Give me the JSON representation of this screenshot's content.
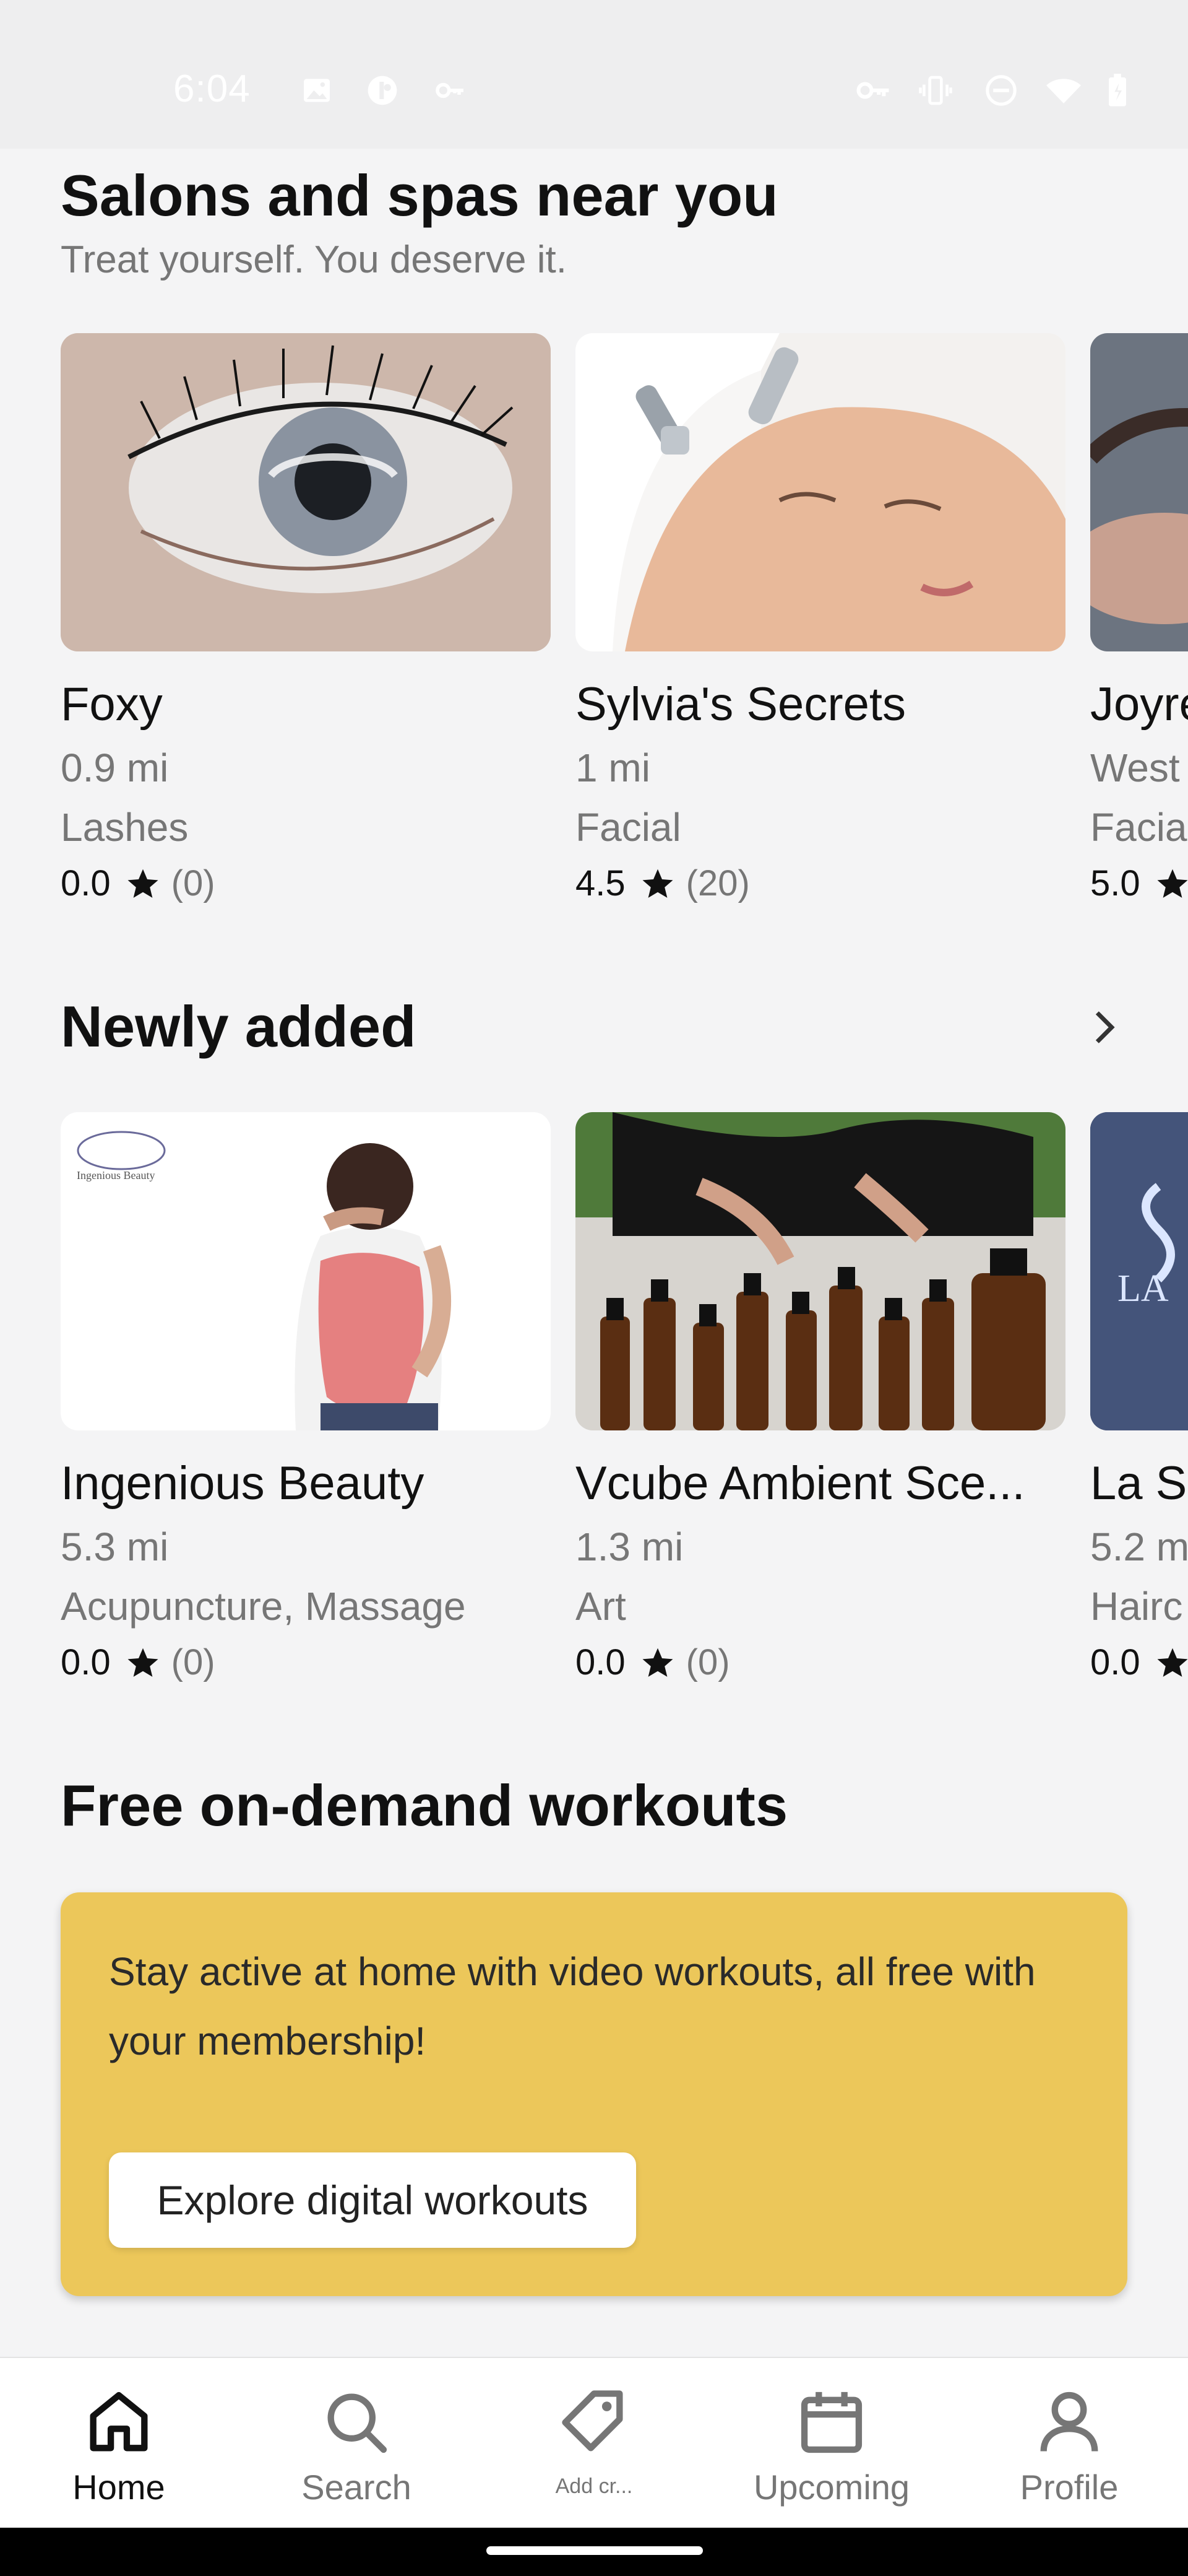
{
  "status_bar": {
    "time": "6:04",
    "left_icons": [
      "image-icon",
      "privacy-icon",
      "key-icon"
    ],
    "right_icons": [
      "vpn-key-icon",
      "vibrate-icon",
      "dnd-icon",
      "wifi-icon",
      "battery-icon"
    ]
  },
  "salons": {
    "title": "Salons and spas near you",
    "subtitle": "Treat yourself. You deserve it.",
    "cards": [
      {
        "name": "Foxy",
        "distance": "0.9 mi",
        "category": "Lashes",
        "rating": "0.0",
        "count": "(0)"
      },
      {
        "name": "Sylvia's Secrets",
        "distance": "1 mi",
        "category": "Facial",
        "rating": "4.5",
        "count": "(20)"
      },
      {
        "name": "Joyre",
        "distance": "West",
        "category": "Facia",
        "rating": "5.0",
        "count": ""
      }
    ]
  },
  "newly_added": {
    "title": "Newly added",
    "cards": [
      {
        "name": "Ingenious Beauty",
        "distance": "5.3 mi",
        "category": "Acupuncture, Massage",
        "rating": "0.0",
        "count": "(0)",
        "logo_text": "Ingenious Beauty"
      },
      {
        "name": "Vcube Ambient Sce...",
        "distance": "1.3 mi",
        "category": "Art",
        "rating": "0.0",
        "count": "(0)"
      },
      {
        "name": "La Sc",
        "distance": "5.2 m",
        "category": "Hairc",
        "rating": "0.0",
        "count": "",
        "sign_text": "LA"
      }
    ]
  },
  "workouts": {
    "title": "Free on-demand workouts",
    "promo_text": "Stay active at home with video workouts, all free with your membership!",
    "button_label": "Explore digital workouts"
  },
  "nav": {
    "items": [
      {
        "label": "Home",
        "icon": "home-icon",
        "active": true
      },
      {
        "label": "Search",
        "icon": "search-icon",
        "active": false
      },
      {
        "label": "Add cr...",
        "icon": "tag-icon",
        "active": false
      },
      {
        "label": "Upcoming",
        "icon": "calendar-icon",
        "active": false
      },
      {
        "label": "Profile",
        "icon": "profile-icon",
        "active": false
      }
    ]
  },
  "colors": {
    "background": "#f4f4f5",
    "promo": "#ecc75a",
    "muted_text": "#767676"
  }
}
